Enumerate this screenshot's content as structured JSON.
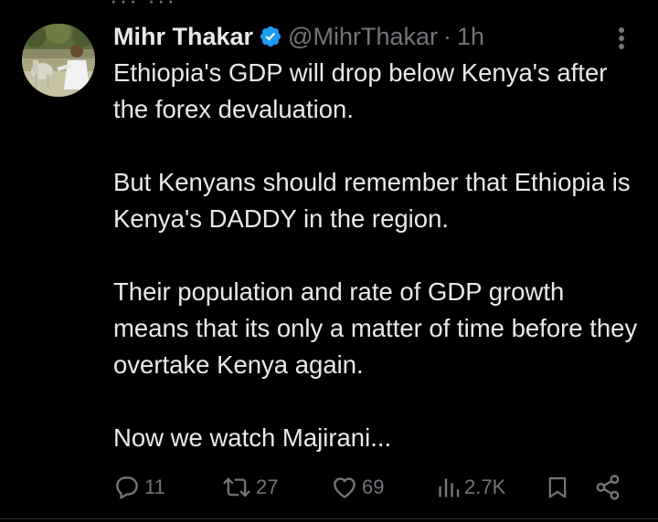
{
  "tweet": {
    "display_name": "Mihr Thakar",
    "handle": "@MihrThakar",
    "separator": "·",
    "time": "1h",
    "paragraphs": [
      "Ethiopia's GDP will drop below Kenya's after the forex devaluation.",
      "But Kenyans should remember that Ethiopia is Kenya's DADDY in the region.",
      "Their population and rate of GDP growth means that its only a matter of time before they overtake Kenya again.",
      "Now we watch Majirani..."
    ],
    "actions": {
      "replies": "11",
      "reposts": "27",
      "likes": "69",
      "views": "2.7K"
    }
  },
  "icons": {
    "verified": "verified-badge-icon",
    "more": "more-vertical-icon",
    "reply": "reply-icon",
    "repost": "repost-icon",
    "like": "heart-icon",
    "views": "views-bar-icon",
    "bookmark": "bookmark-icon",
    "share": "share-icon"
  },
  "colors": {
    "background": "#000000",
    "text": "#e7e9ea",
    "secondary": "#71767b",
    "verified": "#1d9bf0"
  }
}
